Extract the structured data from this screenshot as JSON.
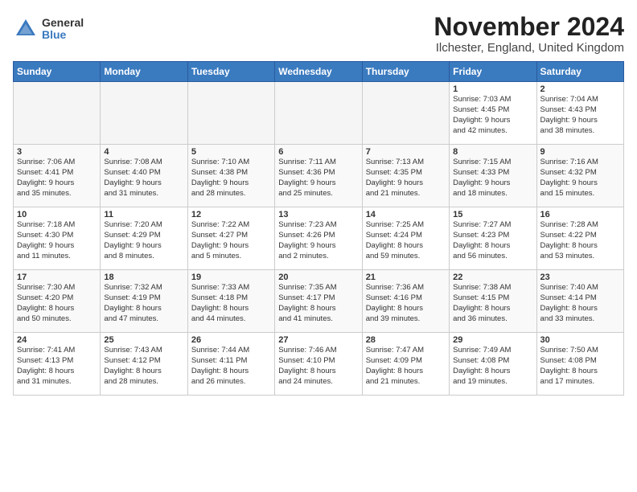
{
  "logo": {
    "general": "General",
    "blue": "Blue"
  },
  "title": {
    "month_year": "November 2024",
    "location": "Ilchester, England, United Kingdom"
  },
  "headers": [
    "Sunday",
    "Monday",
    "Tuesday",
    "Wednesday",
    "Thursday",
    "Friday",
    "Saturday"
  ],
  "weeks": [
    [
      {
        "day": "",
        "info": ""
      },
      {
        "day": "",
        "info": ""
      },
      {
        "day": "",
        "info": ""
      },
      {
        "day": "",
        "info": ""
      },
      {
        "day": "",
        "info": ""
      },
      {
        "day": "1",
        "info": "Sunrise: 7:03 AM\nSunset: 4:45 PM\nDaylight: 9 hours\nand 42 minutes."
      },
      {
        "day": "2",
        "info": "Sunrise: 7:04 AM\nSunset: 4:43 PM\nDaylight: 9 hours\nand 38 minutes."
      }
    ],
    [
      {
        "day": "3",
        "info": "Sunrise: 7:06 AM\nSunset: 4:41 PM\nDaylight: 9 hours\nand 35 minutes."
      },
      {
        "day": "4",
        "info": "Sunrise: 7:08 AM\nSunset: 4:40 PM\nDaylight: 9 hours\nand 31 minutes."
      },
      {
        "day": "5",
        "info": "Sunrise: 7:10 AM\nSunset: 4:38 PM\nDaylight: 9 hours\nand 28 minutes."
      },
      {
        "day": "6",
        "info": "Sunrise: 7:11 AM\nSunset: 4:36 PM\nDaylight: 9 hours\nand 25 minutes."
      },
      {
        "day": "7",
        "info": "Sunrise: 7:13 AM\nSunset: 4:35 PM\nDaylight: 9 hours\nand 21 minutes."
      },
      {
        "day": "8",
        "info": "Sunrise: 7:15 AM\nSunset: 4:33 PM\nDaylight: 9 hours\nand 18 minutes."
      },
      {
        "day": "9",
        "info": "Sunrise: 7:16 AM\nSunset: 4:32 PM\nDaylight: 9 hours\nand 15 minutes."
      }
    ],
    [
      {
        "day": "10",
        "info": "Sunrise: 7:18 AM\nSunset: 4:30 PM\nDaylight: 9 hours\nand 11 minutes."
      },
      {
        "day": "11",
        "info": "Sunrise: 7:20 AM\nSunset: 4:29 PM\nDaylight: 9 hours\nand 8 minutes."
      },
      {
        "day": "12",
        "info": "Sunrise: 7:22 AM\nSunset: 4:27 PM\nDaylight: 9 hours\nand 5 minutes."
      },
      {
        "day": "13",
        "info": "Sunrise: 7:23 AM\nSunset: 4:26 PM\nDaylight: 9 hours\nand 2 minutes."
      },
      {
        "day": "14",
        "info": "Sunrise: 7:25 AM\nSunset: 4:24 PM\nDaylight: 8 hours\nand 59 minutes."
      },
      {
        "day": "15",
        "info": "Sunrise: 7:27 AM\nSunset: 4:23 PM\nDaylight: 8 hours\nand 56 minutes."
      },
      {
        "day": "16",
        "info": "Sunrise: 7:28 AM\nSunset: 4:22 PM\nDaylight: 8 hours\nand 53 minutes."
      }
    ],
    [
      {
        "day": "17",
        "info": "Sunrise: 7:30 AM\nSunset: 4:20 PM\nDaylight: 8 hours\nand 50 minutes."
      },
      {
        "day": "18",
        "info": "Sunrise: 7:32 AM\nSunset: 4:19 PM\nDaylight: 8 hours\nand 47 minutes."
      },
      {
        "day": "19",
        "info": "Sunrise: 7:33 AM\nSunset: 4:18 PM\nDaylight: 8 hours\nand 44 minutes."
      },
      {
        "day": "20",
        "info": "Sunrise: 7:35 AM\nSunset: 4:17 PM\nDaylight: 8 hours\nand 41 minutes."
      },
      {
        "day": "21",
        "info": "Sunrise: 7:36 AM\nSunset: 4:16 PM\nDaylight: 8 hours\nand 39 minutes."
      },
      {
        "day": "22",
        "info": "Sunrise: 7:38 AM\nSunset: 4:15 PM\nDaylight: 8 hours\nand 36 minutes."
      },
      {
        "day": "23",
        "info": "Sunrise: 7:40 AM\nSunset: 4:14 PM\nDaylight: 8 hours\nand 33 minutes."
      }
    ],
    [
      {
        "day": "24",
        "info": "Sunrise: 7:41 AM\nSunset: 4:13 PM\nDaylight: 8 hours\nand 31 minutes."
      },
      {
        "day": "25",
        "info": "Sunrise: 7:43 AM\nSunset: 4:12 PM\nDaylight: 8 hours\nand 28 minutes."
      },
      {
        "day": "26",
        "info": "Sunrise: 7:44 AM\nSunset: 4:11 PM\nDaylight: 8 hours\nand 26 minutes."
      },
      {
        "day": "27",
        "info": "Sunrise: 7:46 AM\nSunset: 4:10 PM\nDaylight: 8 hours\nand 24 minutes."
      },
      {
        "day": "28",
        "info": "Sunrise: 7:47 AM\nSunset: 4:09 PM\nDaylight: 8 hours\nand 21 minutes."
      },
      {
        "day": "29",
        "info": "Sunrise: 7:49 AM\nSunset: 4:08 PM\nDaylight: 8 hours\nand 19 minutes."
      },
      {
        "day": "30",
        "info": "Sunrise: 7:50 AM\nSunset: 4:08 PM\nDaylight: 8 hours\nand 17 minutes."
      }
    ]
  ]
}
